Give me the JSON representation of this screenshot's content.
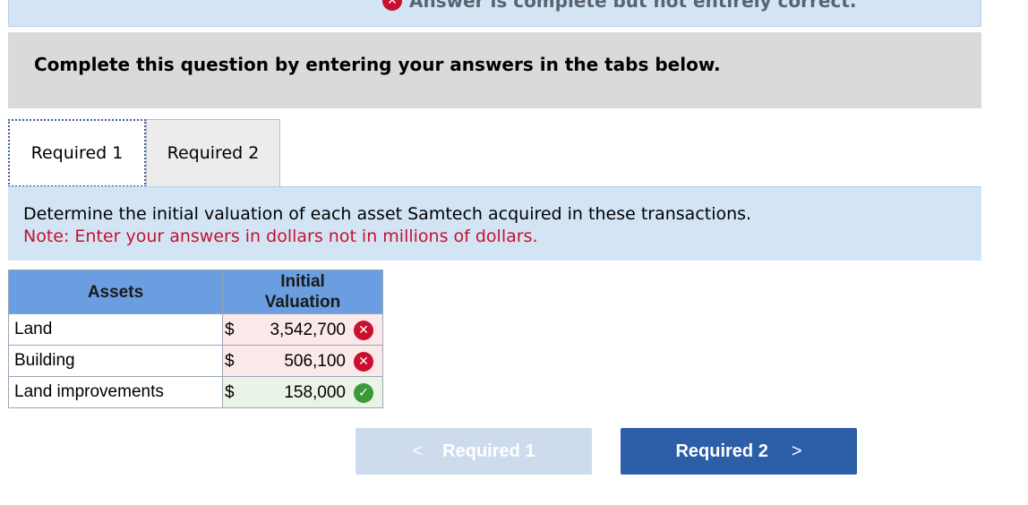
{
  "banner": {
    "status_text": "Answer is complete but not entirely correct.",
    "icon": "x-circle-icon"
  },
  "question": {
    "prompt": "Complete this question by entering your answers in the tabs below."
  },
  "tabs": [
    {
      "label": "Required 1",
      "active": true
    },
    {
      "label": "Required 2",
      "active": false
    }
  ],
  "instructions": {
    "text": "Determine the initial valuation of each asset Samtech acquired in these transactions.",
    "note": "Note: Enter your answers in dollars not in millions of dollars."
  },
  "table": {
    "headers": [
      "Assets",
      "Initial\nValuation"
    ],
    "header_lines": [
      "Initial",
      "Valuation"
    ],
    "rows": [
      {
        "asset": "Land",
        "currency": "$",
        "value": "3,542,700",
        "result": "incorrect"
      },
      {
        "asset": "Building",
        "currency": "$",
        "value": "506,100",
        "result": "incorrect"
      },
      {
        "asset": "Land improvements",
        "currency": "$",
        "value": "158,000",
        "result": "correct"
      }
    ]
  },
  "navigation": {
    "prev_label": "Required 1",
    "next_label": "Required 2",
    "prev_chevron": "<",
    "next_chevron": ">"
  },
  "colors": {
    "incorrect": "#c8102e",
    "correct": "#3a9a3a",
    "header_blue": "#6a9ee0",
    "next_button": "#2d5ea8"
  }
}
